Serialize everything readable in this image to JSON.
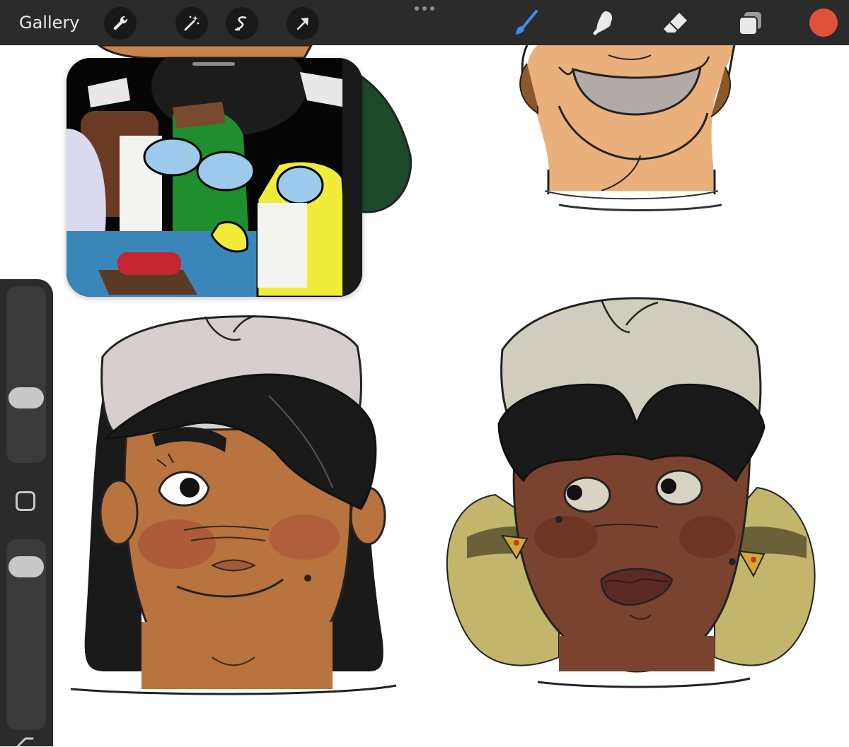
{
  "toolbar": {
    "gallery_label": "Gallery",
    "left_tools": [
      {
        "name": "wrench-icon"
      },
      {
        "name": "magic-wand-icon"
      },
      {
        "name": "selection-icon"
      },
      {
        "name": "transform-arrow-icon"
      }
    ],
    "more_icon": "ellipsis-icon",
    "right_tools": [
      {
        "name": "brush-icon",
        "active": true
      },
      {
        "name": "smudge-icon"
      },
      {
        "name": "eraser-icon"
      },
      {
        "name": "layers-icon"
      }
    ],
    "active_color": "#e0513a",
    "accent": "#3a8ef0"
  },
  "sidebar": {
    "brush_size_level": 0.35,
    "opacity_level": 0.9
  }
}
